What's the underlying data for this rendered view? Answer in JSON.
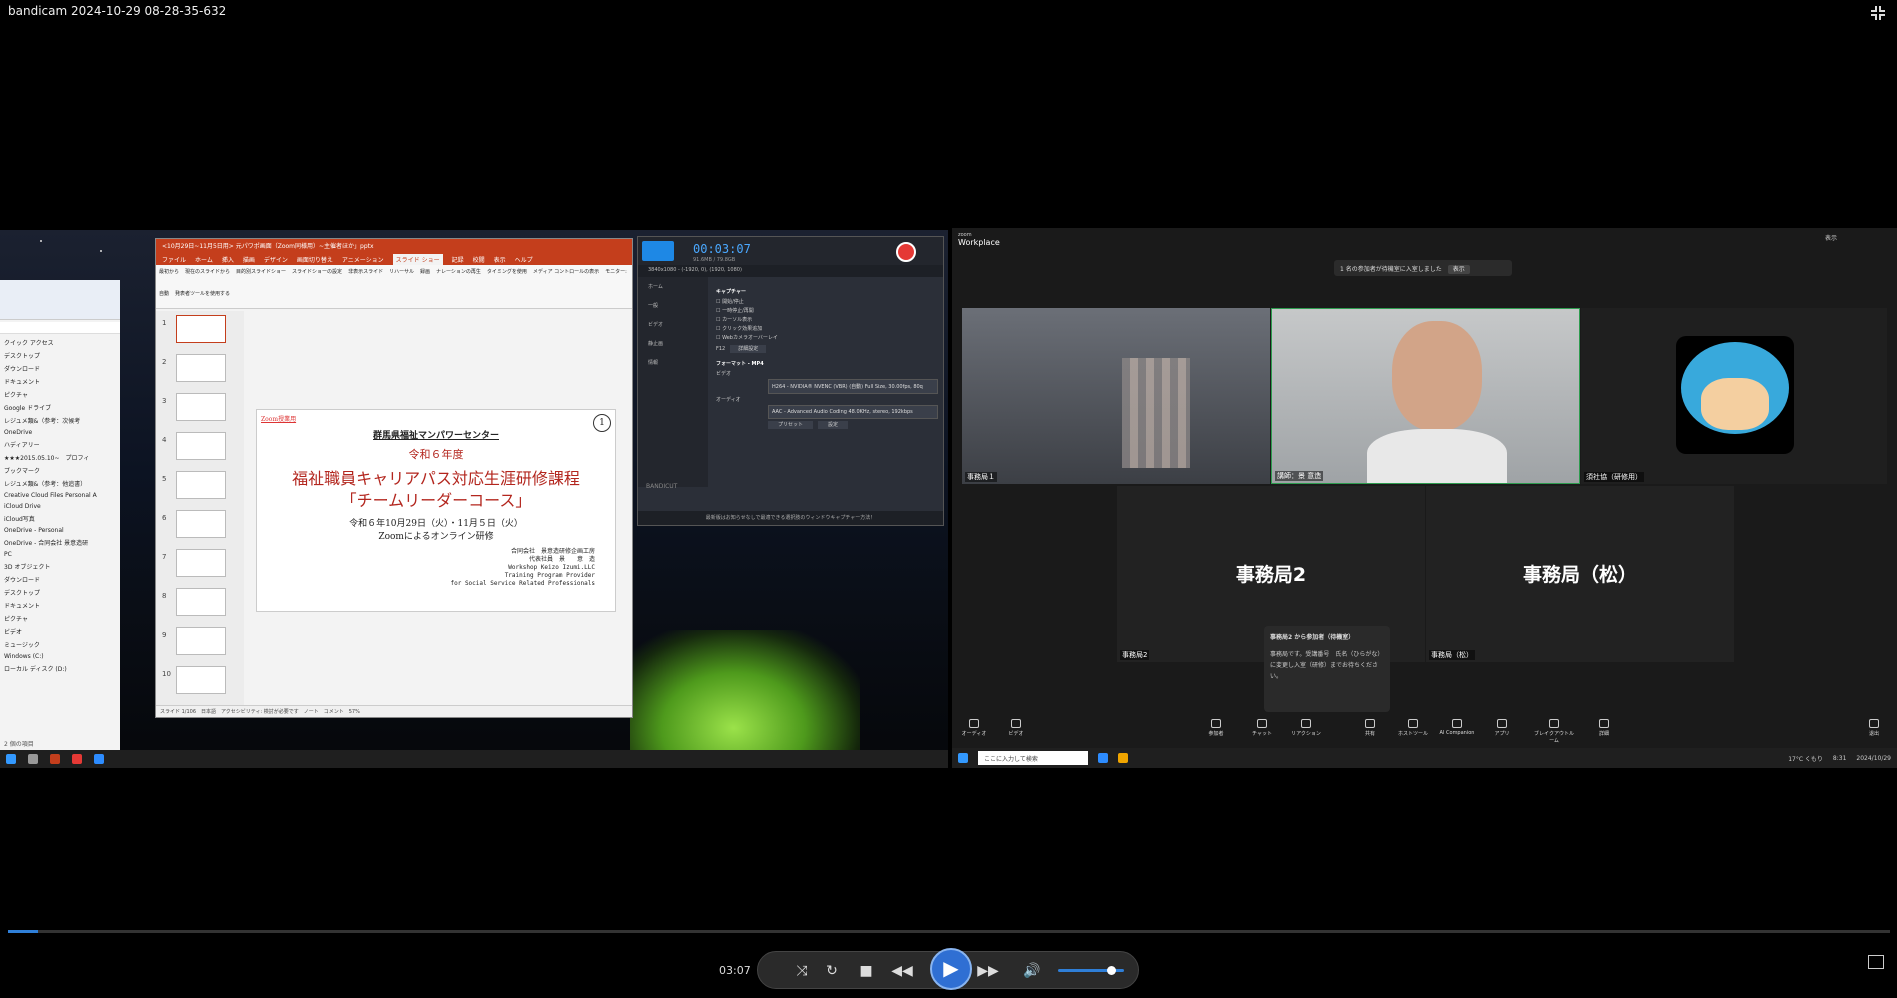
{
  "window": {
    "title": "bandicam 2024-10-29 08-28-35-632"
  },
  "powerpoint": {
    "title": "<10月29日~11月5日用> 元パワポ画面（Zoom同様用）~主催者ほか」pptx",
    "tabs": [
      "ファイル",
      "ホーム",
      "挿入",
      "描画",
      "デザイン",
      "画面切り替え",
      "アニメーション",
      "スライド ショー",
      "記録",
      "校閲",
      "表示",
      "ヘルプ"
    ],
    "active_tab": "スライド ショー",
    "ribbon_items": [
      "最初から",
      "現在のスライドから",
      "目的別スライドショー",
      "スライドショーの設定",
      "非表示スライド",
      "リハーサル",
      "録画",
      "ナレーションの再生",
      "タイミングを使用",
      "メディア コントロールの表示",
      "モニター:",
      "自動",
      "発表者ツールを使用する"
    ],
    "thumb_numbers": [
      "1",
      "2",
      "3",
      "4",
      "5",
      "6",
      "7",
      "8",
      "9",
      "10"
    ],
    "slide": {
      "tag": "Zoom授業用",
      "page_no": "1",
      "org": "群馬県福祉マンパワーセンター",
      "year": "令和６年度",
      "main_title_1": "福祉職員キャリアパス対応生涯研修課程",
      "main_title_2": "「チームリーダーコース」",
      "dates": "令和６年10月29日（火）・11月５日（火）",
      "mode": "Zoomによるオンライン研修",
      "company": "合同会社　景意造研修企画工房",
      "rep": "代表社員　景　　意　造",
      "en1": "Workshop Keizo Izumi.LLC",
      "en2": "Training Program Provider",
      "en3": "for Social Service Related Professionals"
    },
    "status": "スライド 1/106　日本語　アクセシビリティ: 検討が必要です　ノート　コメント　57%"
  },
  "bandicam": {
    "brand": "BANDICAM",
    "timer": "00:03:07",
    "size": "91.6MB / 79.8GB",
    "mode": "3840x1080 - (-1920, 0), (1920, 1080)",
    "side_items": [
      "ホーム",
      "一般",
      "ビデオ",
      "静止画",
      "情報"
    ],
    "capture_header": "キャプチャー",
    "options": [
      "開始/停止",
      "一時停止/再開",
      "カーソル表示",
      "クリック効果追加",
      "Webカメラオーバーレイ"
    ],
    "hotkey": "F12",
    "detail_btn": "詳細設定",
    "format_header": "フォーマット - MP4",
    "video_label": "ビデオ",
    "video_value": "H264 - NVIDIA® NVENC (VBR) (自動) Full Size, 30.00fps, 80q",
    "audio_label": "オーディオ",
    "audio_value": "AAC - Advanced Audio Coding 48.0KHz, stereo, 192kbps",
    "preset_btn": "プリセット",
    "settings_btn": "設定",
    "footer": "最新版はお知らせなしで最適できる選択肢のウィンドウキャプチャー方法！",
    "cut_label": "BANDICUT"
  },
  "explorer": {
    "items": [
      "クイック アクセス",
      "デスクトップ",
      "ダウンロード",
      "ドキュメント",
      "ピクチャ",
      "Google ドライブ",
      "レジュメ類&（参考：次候考",
      "OneDrive",
      "ハディアリー",
      "★★★2015.05.10~　プロフィ",
      "ブックマーク",
      "レジュメ類&（参考：他追書）",
      "Creative Cloud Files Personal A",
      "iCloud Drive",
      "iCloud写真",
      "OneDrive - Personal",
      "OneDrive - 合同会社 景意造研",
      "PC",
      "3D オブジェクト",
      "ダウンロード",
      "デスクトップ",
      "ドキュメント",
      "ピクチャ",
      "ビデオ",
      "ミュージック",
      "Windows (C:)",
      "ローカル ディスク (D:)"
    ],
    "count": "2 個の項目"
  },
  "zoom": {
    "logo_top": "zoom",
    "logo": "Workplace",
    "waiting_text": "1 名の参加者が待機室に入室しました",
    "waiting_show": "表示",
    "tiles": [
      {
        "name": "事務局１"
      },
      {
        "name": "講師：景 意造"
      },
      {
        "name": "須社協（研修用）"
      },
      {
        "name": "事務局2",
        "big": "事務局2"
      },
      {
        "name": "事務局（松）",
        "big": "事務局（松）"
      }
    ],
    "chat_title": "事務局2 から参加者（待機室）",
    "chat_body": "事務局です。受講番号　氏名（ひらがな）　に変更し入室（研修）までお待ちください。",
    "toolbar": [
      "オーディオ",
      "ビデオ",
      "参加者",
      "チャット",
      "リアクション",
      "共有",
      "ホストツール",
      "AI Companion",
      "アプリ",
      "ブレイクアウトルーム",
      "詳細",
      "退出"
    ],
    "header_view": "表示"
  },
  "taskbar": {
    "search_placeholder": "ここに入力して検索",
    "weather": "17°C くもり",
    "time": "8:31",
    "date": "2024/10/29"
  },
  "player": {
    "time": "03:07",
    "progress": 0.016,
    "volume": 0.8
  },
  "colors": {
    "accent": "#2f6fd3",
    "ppt": "#c43e1c",
    "rec": "#e53935"
  }
}
